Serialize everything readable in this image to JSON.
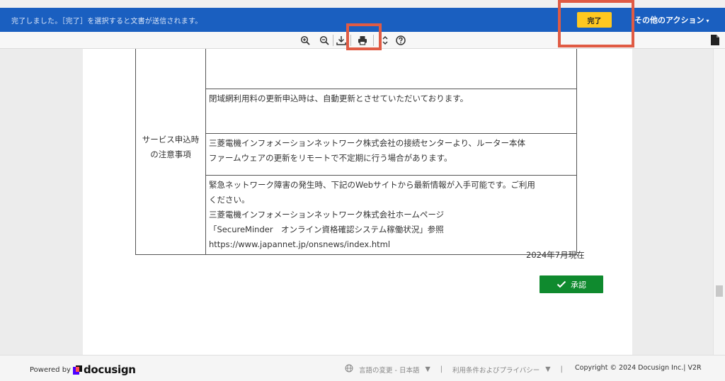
{
  "topbar": {
    "message": "完了しました。［完了］を選択すると文書が送信されます。",
    "finish_label": "完了",
    "other_actions_label": "その他のアクション",
    "caret": "▾"
  },
  "toolbar": {
    "icons": [
      "zoom-in-icon",
      "zoom-out-icon",
      "download-icon",
      "print-icon",
      "fields-icon",
      "help-icon"
    ]
  },
  "document": {
    "section_label": "サービス申込時の注意事項",
    "rows": [
      [
        "閉域網利用料の更新申込時は、自動更新とさせていただいております。"
      ],
      [
        "三菱電機インフォメーションネットワーク株式会社の接続センターより、ルーター本体",
        "ファームウェアの更新をリモートで不定期に行う場合があります。"
      ],
      [
        "緊急ネットワーク障害の発生時、下記のWebサイトから最新情報が入手可能です。ご利用",
        "ください。",
        "三菱電機インフォメーションネットワーク株式会社ホームページ",
        "「SecureMinder　オンライン資格確認システム稼働状況」参照",
        "https://www.japannet.jp/onsnews/index.html"
      ]
    ],
    "date_note": "2024年7月現在",
    "approve_label": "承認"
  },
  "footer": {
    "powered_by": "Powered by",
    "brand": "docusign",
    "language": "言語の変更 - 日本語",
    "terms": "利用条件およびプライバシー",
    "separator": "|",
    "copyright": "Copyright © 2024 Docusign Inc.| V2R"
  },
  "colors": {
    "topbar": "#1a5fc0",
    "finish_button": "#ffc820",
    "approve_button": "#0f8a2e",
    "highlight": "#e05b44"
  }
}
